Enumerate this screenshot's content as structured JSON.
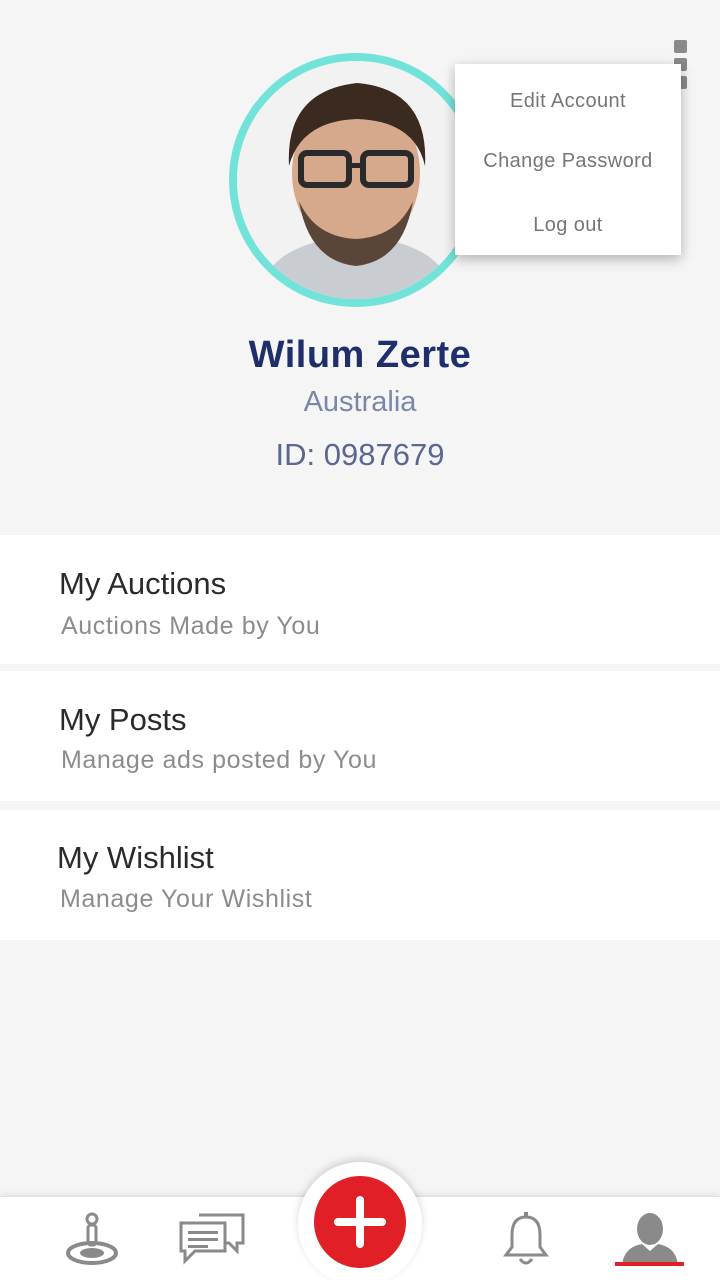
{
  "profile": {
    "name": "Wilum Zerte",
    "country": "Australia",
    "id_label": "ID: 0987679"
  },
  "overflow_menu": {
    "items": [
      "Edit Account",
      "Change Password",
      "Log out"
    ]
  },
  "list": [
    {
      "title": "My Auctions",
      "subtitle": "Auctions Made by You"
    },
    {
      "title": "My Posts",
      "subtitle": "Manage ads posted by You"
    },
    {
      "title": "My Wishlist",
      "subtitle": "Manage Your Wishlist"
    }
  ],
  "bottom_nav": {
    "items": [
      {
        "icon": "location-pin-icon",
        "active": false
      },
      {
        "icon": "chat-icon",
        "active": false
      },
      {
        "icon": "add-icon",
        "active": false
      },
      {
        "icon": "bell-icon",
        "active": false
      },
      {
        "icon": "user-icon",
        "active": true
      }
    ],
    "accent": "#e01f26"
  },
  "colors": {
    "accent": "#e01f26",
    "avatar_ring": "#72e3d8",
    "name": "#1e2f6b"
  }
}
